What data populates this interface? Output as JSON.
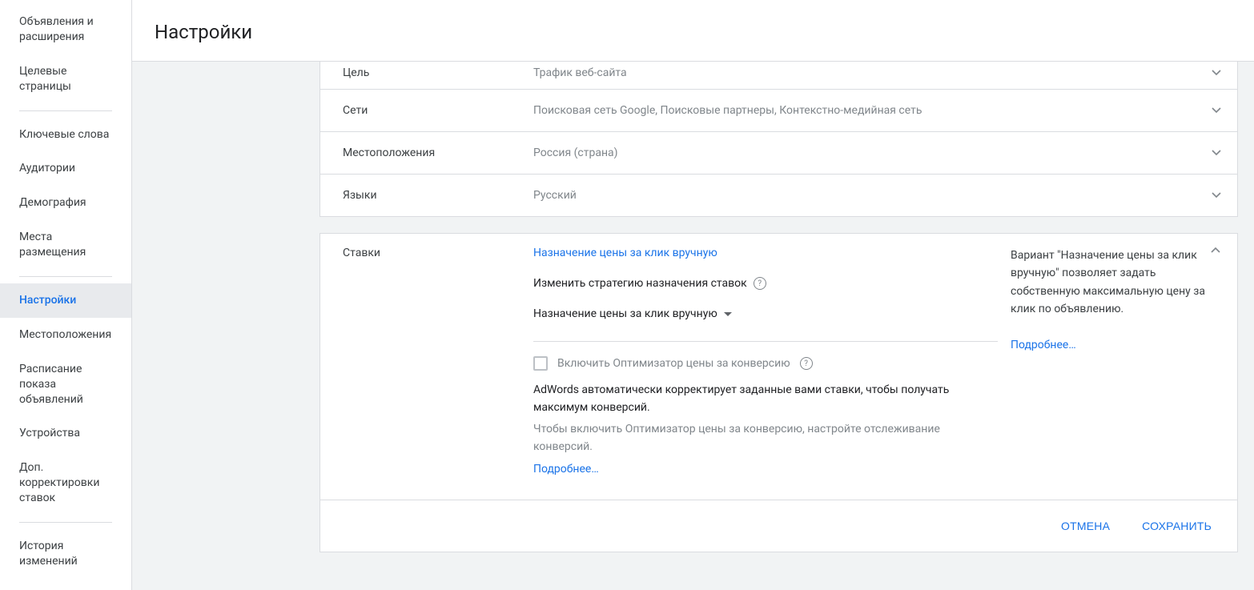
{
  "header": {
    "title": "Настройки"
  },
  "sidebar": {
    "items": [
      {
        "label": "Объявления и расширения",
        "active": false
      },
      {
        "label": "Целевые страницы",
        "active": false
      },
      {
        "divider": true
      },
      {
        "label": "Ключевые слова",
        "active": false
      },
      {
        "label": "Аудитории",
        "active": false
      },
      {
        "label": "Демография",
        "active": false
      },
      {
        "label": "Места размещения",
        "active": false
      },
      {
        "divider": true
      },
      {
        "label": "Настройки",
        "active": true
      },
      {
        "label": "Местоположения",
        "active": false
      },
      {
        "label": "Расписание показа объявлений",
        "active": false
      },
      {
        "label": "Устройства",
        "active": false
      },
      {
        "label": "Доп. корректировки ставок",
        "active": false
      },
      {
        "divider": true
      },
      {
        "label": "История изменений",
        "active": false
      }
    ]
  },
  "collapsed_rows": [
    {
      "label": "Цель",
      "value": "Трафик веб-сайта"
    },
    {
      "label": "Сети",
      "value": "Поисковая сеть Google, Поисковые партнеры, Контекстно-медийная сеть"
    },
    {
      "label": "Местоположения",
      "value": "Россия (страна)"
    },
    {
      "label": "Языки",
      "value": "Русский"
    }
  ],
  "bidding": {
    "section_label": "Ставки",
    "current_strategy": "Назначение цены за клик вручную",
    "change_strategy_label": "Изменить стратегию назначения ставок",
    "dropdown_value": "Назначение цены за клик вручную",
    "optimizer_checkbox": "Включить Оптимизатор цены за конверсию",
    "optimizer_desc": "AdWords автоматически корректирует заданные вами ставки, чтобы получать максимум конверсий.",
    "optimizer_note": "Чтобы включить Оптимизатор цены за конверсию, настройте отслеживание конверсий.",
    "more_link": "Подробнее…",
    "side_note": "Вариант \"Назначение цены за клик вручную\" позволяет задать собственную максимальную цену за клик по объявлению.",
    "side_more": "Подробнее…"
  },
  "actions": {
    "cancel": "ОТМЕНА",
    "save": "СОХРАНИТЬ"
  }
}
